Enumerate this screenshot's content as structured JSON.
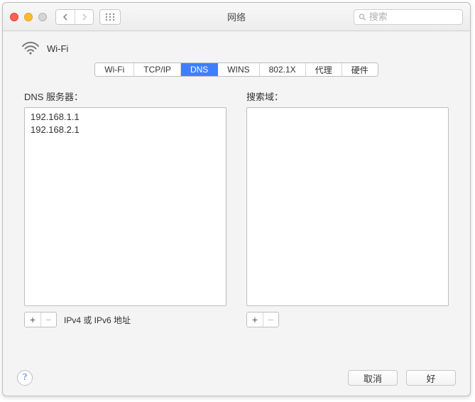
{
  "window": {
    "title": "网络",
    "search_placeholder": "搜索"
  },
  "interface": {
    "name": "Wi-Fi"
  },
  "tabs": [
    {
      "label": "Wi-Fi",
      "selected": false
    },
    {
      "label": "TCP/IP",
      "selected": false
    },
    {
      "label": "DNS",
      "selected": true
    },
    {
      "label": "WINS",
      "selected": false
    },
    {
      "label": "802.1X",
      "selected": false
    },
    {
      "label": "代理",
      "selected": false
    },
    {
      "label": "硬件",
      "selected": false
    }
  ],
  "dns_panel": {
    "label": "DNS 服务器：",
    "entries": [
      "192.168.1.1",
      "192.168.2.1"
    ],
    "footer_hint": "IPv4 或 IPv6 地址"
  },
  "search_domain_panel": {
    "label": "搜索域：",
    "entries": []
  },
  "buttons": {
    "cancel": "取消",
    "ok": "好"
  }
}
